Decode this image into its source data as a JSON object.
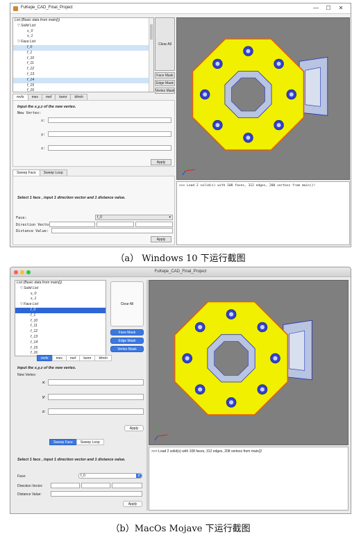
{
  "shot_a": {
    "window_title": "FuKejie_CAD_Final_Project",
    "controls": [
      "—",
      "☐",
      "✕"
    ],
    "tree": [
      {
        "label": "List (Basic data from main())",
        "indent": 0,
        "arrow": ""
      },
      {
        "label": "Solid List",
        "indent": 1,
        "arrow": "▽"
      },
      {
        "label": "s_0",
        "indent": 2,
        "arrow": ""
      },
      {
        "label": "s_1",
        "indent": 2,
        "arrow": ""
      },
      {
        "label": "Face List",
        "indent": 1,
        "arrow": "▽"
      },
      {
        "label": "f_0",
        "indent": 2,
        "arrow": "",
        "selected": true
      },
      {
        "label": "f_1",
        "indent": 2,
        "arrow": ""
      },
      {
        "label": "f_10",
        "indent": 2,
        "arrow": ""
      },
      {
        "label": "f_11",
        "indent": 2,
        "arrow": ""
      },
      {
        "label": "f_12",
        "indent": 2,
        "arrow": ""
      },
      {
        "label": "f_13",
        "indent": 2,
        "arrow": ""
      },
      {
        "label": "f_14",
        "indent": 2,
        "arrow": "",
        "selected": true
      },
      {
        "label": "f_15",
        "indent": 2,
        "arrow": ""
      },
      {
        "label": "f_16",
        "indent": 2,
        "arrow": ""
      },
      {
        "label": "f_17",
        "indent": 2,
        "arrow": ""
      }
    ],
    "clear_all": "Clear All",
    "face_mask": "Face Mask",
    "edge_mask": "Edge Mask",
    "vertex_mask": "Vertex Mask",
    "op_tabs": [
      "mvfs",
      "mev",
      "mef",
      "kemr",
      "kfmrh"
    ],
    "prompt": "Input the x,y,z of the new vertex.",
    "new_vertex": "New Vertex:",
    "x": "x:",
    "y": "y:",
    "z": "z:",
    "apply": "Apply",
    "sweep_tabs": [
      "Sweep Face",
      "Sweep Loop"
    ],
    "sweep_prompt": "Select 1 face , input 1 direction vector and 1 distance value.",
    "face_label": "Face:",
    "face_value": "f_0",
    "direction_label": "Direction Vector:",
    "distance_label": "Distance Value:",
    "console": ">>> Load 2 solid(s) with 108 faces, 312 edges, 208 vertexs from main()!"
  },
  "caption_a": "（a） Windows 10 下运行截图",
  "shot_b": {
    "window_title": "FuKejie_CAD_Final_Project",
    "tree": [
      {
        "label": "List (Basic data from main())",
        "indent": 0,
        "arrow": ""
      },
      {
        "label": "Solid List",
        "indent": 1,
        "arrow": "▽"
      },
      {
        "label": "s_0",
        "indent": 2,
        "arrow": ""
      },
      {
        "label": "s_1",
        "indent": 2,
        "arrow": ""
      },
      {
        "label": "Face List",
        "indent": 1,
        "arrow": "▽"
      },
      {
        "label": "f_0",
        "indent": 2,
        "arrow": "",
        "selected": true
      },
      {
        "label": "f_1",
        "indent": 2,
        "arrow": ""
      },
      {
        "label": "f_10",
        "indent": 2,
        "arrow": ""
      },
      {
        "label": "f_11",
        "indent": 2,
        "arrow": ""
      },
      {
        "label": "f_12",
        "indent": 2,
        "arrow": ""
      },
      {
        "label": "f_13",
        "indent": 2,
        "arrow": ""
      },
      {
        "label": "f_14",
        "indent": 2,
        "arrow": ""
      },
      {
        "label": "f_15",
        "indent": 2,
        "arrow": ""
      },
      {
        "label": "f_16",
        "indent": 2,
        "arrow": ""
      },
      {
        "label": "f_17",
        "indent": 2,
        "arrow": ""
      },
      {
        "label": "f_18",
        "indent": 2,
        "arrow": ""
      },
      {
        "label": "f_19",
        "indent": 2,
        "arrow": ""
      },
      {
        "label": "f_2",
        "indent": 2,
        "arrow": ""
      },
      {
        "label": "f_20",
        "indent": 2,
        "arrow": ""
      }
    ],
    "clear_all": "Clear All",
    "face_mask": "Face Mask",
    "edge_mask": "Edge Mask",
    "vertex_mask": "Vertex Mask",
    "op_tabs": [
      "mvfs",
      "mev",
      "mef",
      "kemr",
      "kfmrh"
    ],
    "prompt": "Input the x,y,z of the new vertex.",
    "new_vertex": "New Vertex:",
    "x": "x:",
    "y": "y:",
    "z": "z:",
    "apply": "Apply",
    "sweep_tabs": [
      "Sweep Face",
      "Sweep Loop"
    ],
    "sweep_prompt": "Select 1 face , input 1 direction vector and 1 distance value.",
    "face_label": "Face:",
    "face_value": "f_0",
    "direction_label": "Direction Vector:",
    "distance_label": "Distance Value:",
    "console": ">>> Load 2 solid(s) with 108 faces, 312 edges, 208 vertexs from main()!"
  },
  "caption_b": "（b）MacOs Mojave 下运行截图",
  "colors": {
    "face_fill": "#f0f000",
    "face_edge": "#e06010",
    "hole_fill": "#3040d0",
    "ring_fill": "#b8c4e0",
    "viewport_bg": "#808080",
    "mac_accent": "#3b78e0"
  }
}
